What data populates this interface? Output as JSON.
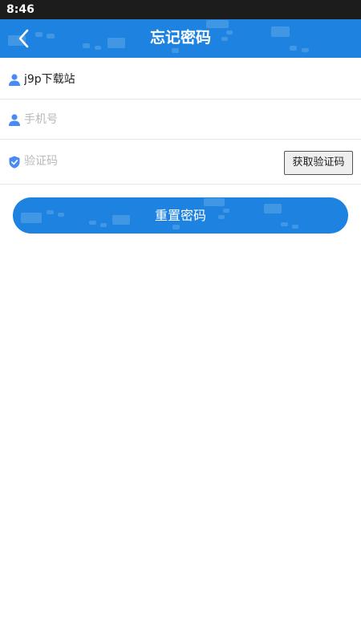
{
  "status_bar": {
    "time": "8:46"
  },
  "header": {
    "title": "忘记密码",
    "back_icon": "chevron-left-icon"
  },
  "form": {
    "account": {
      "value": "j9p下载站",
      "icon": "user-icon"
    },
    "phone": {
      "placeholder": "手机号",
      "icon": "user-icon"
    },
    "code": {
      "placeholder": "验证码",
      "icon": "shield-check-icon",
      "get_code_label": "获取验证码"
    }
  },
  "reset_button": {
    "label": "重置密码"
  },
  "colors": {
    "primary": "#1e83e0",
    "icon": "#4a8af4",
    "status_bar": "#1c1c1c"
  }
}
